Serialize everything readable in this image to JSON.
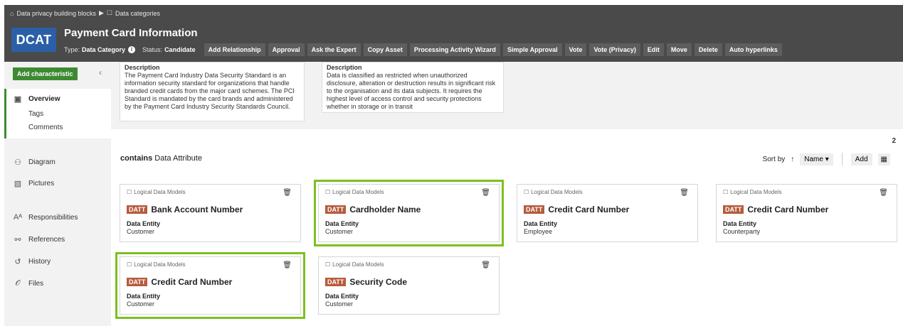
{
  "breadcrumb": {
    "items": [
      {
        "label": "Data privacy building blocks",
        "icon": "community-icon"
      },
      {
        "label": "Data categories",
        "icon": "domain-icon"
      }
    ],
    "separator": "▶"
  },
  "asset": {
    "badge": "DCAT",
    "title": "Payment Card Information",
    "type_label": "Type:",
    "type_value": "Data Category",
    "status_label": "Status:",
    "status_value": "Candidate"
  },
  "actions": [
    "Add Relationship",
    "Approval",
    "Ask the Expert",
    "Copy Asset",
    "Processing Activity Wizard",
    "Simple Approval",
    "Vote",
    "Vote (Privacy)",
    "Edit",
    "Move",
    "Delete",
    "Auto hyperlinks"
  ],
  "sidebar": {
    "add_characteristic": "Add characteristic",
    "collapse_icon": "chevron-left-icon",
    "items": [
      {
        "label": "Overview",
        "icon": "overview-icon"
      },
      {
        "label": "Tags"
      },
      {
        "label": "Comments"
      },
      {
        "label": "Diagram",
        "icon": "diagram-icon"
      },
      {
        "label": "Pictures",
        "icon": "pictures-icon"
      },
      {
        "label": "Responsibilities",
        "icon": "responsibilities-icon"
      },
      {
        "label": "References",
        "icon": "references-icon"
      },
      {
        "label": "History",
        "icon": "history-icon"
      },
      {
        "label": "Files",
        "icon": "paperclip-icon"
      }
    ]
  },
  "descriptions": [
    {
      "label": "Description",
      "text": "The Payment Card Industry Data Security Standard is an information security standard for organizations that handle branded credit cards from the major card schemes. The PCI Standard is mandated by the card brands and administered by the Payment Card Industry Security Standards Council."
    },
    {
      "label": "Description",
      "text": "Data is classified as restricted when unauthorized disclosure, alteration or destruction results in significant risk to the organisation and its data subjects. It requires the highest level of access control and security protections whether  in storage or in transit"
    }
  ],
  "relations": {
    "count": "2",
    "contains_bold": "contains",
    "contains_rest": "Data Attribute",
    "sort_label": "Sort by",
    "sort_dir": "↑",
    "sort_value": "Name ▾",
    "add_label": "Add",
    "grid_icon": "grid-view-icon"
  },
  "cards": [
    {
      "domain": "Logical Data Models",
      "badge": "DATT",
      "name": "Bank Account Number",
      "entity_label": "Data Entity",
      "entity_value": "Customer",
      "highlight": false
    },
    {
      "domain": "Logical Data Models",
      "badge": "DATT",
      "name": "Cardholder Name",
      "entity_label": "Data Entity",
      "entity_value": "Customer",
      "highlight": true
    },
    {
      "domain": "Logical Data Models",
      "badge": "DATT",
      "name": "Credit Card Number",
      "entity_label": "Data Entity",
      "entity_value": "Employee",
      "highlight": false
    },
    {
      "domain": "Logical Data Models",
      "badge": "DATT",
      "name": "Credit Card Number",
      "entity_label": "Data Entity",
      "entity_value": "Counterparty",
      "highlight": false
    },
    {
      "domain": "Logical Data Models",
      "badge": "DATT",
      "name": "Credit Card Number",
      "entity_label": "Data Entity",
      "entity_value": "Customer",
      "highlight": true
    },
    {
      "domain": "Logical Data Models",
      "badge": "DATT",
      "name": "Security Code",
      "entity_label": "Data Entity",
      "entity_value": "Customer",
      "highlight": false
    }
  ],
  "colors": {
    "header_bg": "#4a4a4a",
    "dcat_badge": "#2b5fa8",
    "accent_green": "#3e8a33",
    "highlight_outline": "#7cc020",
    "datt_badge": "#b65b3d"
  }
}
